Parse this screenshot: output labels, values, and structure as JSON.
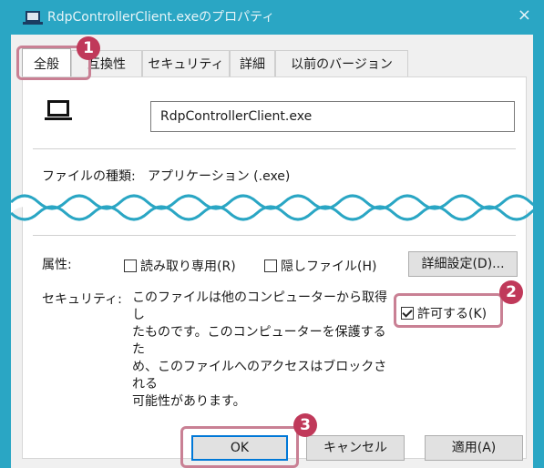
{
  "window": {
    "title": "RdpControllerClient.exeのプロパティ",
    "close": "×"
  },
  "tabs": [
    {
      "label": "全般"
    },
    {
      "label": "互換性"
    },
    {
      "label": "セキュリティ"
    },
    {
      "label": "詳細"
    },
    {
      "label": "以前のバージョン"
    }
  ],
  "file": {
    "name": "RdpControllerClient.exe",
    "type_label": "ファイルの種類:",
    "type_value": "アプリケーション (.exe)"
  },
  "attributes": {
    "label": "属性:",
    "readonly": "読み取り専用(R)",
    "hidden": "隠しファイル(H)",
    "advanced": "詳細設定(D)..."
  },
  "security": {
    "label": "セキュリティ:",
    "lines": [
      "このファイルは他のコンピューターから取得し",
      "たものです。このコンピューターを保護するた",
      "め、このファイルへのアクセスはブロックされる",
      "可能性があります。"
    ],
    "unblock": "許可する(K)"
  },
  "buttons": {
    "ok": "OK",
    "cancel": "キャンセル",
    "apply": "適用(A)"
  },
  "callouts": {
    "one": "1",
    "two": "2",
    "three": "3"
  },
  "colors": {
    "title_bar": "#2aa6c4",
    "callout": "#c0395a",
    "highlight": "#c98094"
  }
}
